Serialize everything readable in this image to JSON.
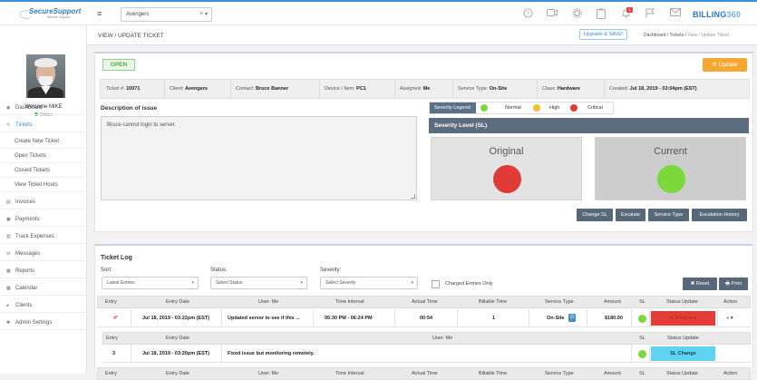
{
  "header": {
    "logo_main": "SecureSupport",
    "logo_sub": "Remote Support",
    "client_value": "Avengers",
    "clear_symbol": "×",
    "notification_count": "1",
    "brand_name": "BILLING",
    "brand_suffix": "360"
  },
  "user": {
    "welcome": "Welcome MIKE",
    "status": "Online"
  },
  "sidebar": {
    "items": [
      {
        "label": "Dashboard",
        "icon": "dashboard-icon"
      },
      {
        "label": "Tickets",
        "icon": "ticket-icon"
      },
      {
        "label": "Invoices",
        "icon": "invoice-icon"
      },
      {
        "label": "Payments",
        "icon": "payment-icon"
      },
      {
        "label": "Track Expenses",
        "icon": "expense-icon"
      },
      {
        "label": "Messages",
        "icon": "message-icon"
      },
      {
        "label": "Reports",
        "icon": "report-icon"
      },
      {
        "label": "Calendar",
        "icon": "calendar-icon"
      },
      {
        "label": "Clients",
        "icon": "clients-icon"
      },
      {
        "label": "Admin Settings",
        "icon": "settings-icon"
      }
    ],
    "subitems": [
      "Create New Ticket",
      "Open Tickets",
      "Closed Tickets",
      "View Ticket Hours"
    ]
  },
  "page": {
    "title": "VIEW / UPDATE TICKET",
    "upgrade_label": "Upgrade & SAVE!",
    "breadcrumb": [
      "Dashboard",
      "Tickets",
      "View / Update Ticket"
    ]
  },
  "ticket": {
    "status": "OPEN",
    "update_label": "Update",
    "info": [
      {
        "label": "Ticket #:",
        "value": "10071"
      },
      {
        "label": "Client:",
        "value": "Avengers"
      },
      {
        "label": "Contact:",
        "value": "Bruce Banner"
      },
      {
        "label": "Device / Item:",
        "value": "PC1"
      },
      {
        "label": "Assigned:",
        "value": "Me"
      },
      {
        "label": "Service Type:",
        "value": "On-Site"
      },
      {
        "label": "Class:",
        "value": "Hardware"
      },
      {
        "label": "Created:",
        "value": "Jul 18, 2019 - 03:04pm (EST)"
      }
    ],
    "description_label": "Description of issue",
    "description": "Bruce cannot login to server."
  },
  "severity": {
    "legend_label": "Severity Legend:",
    "levels": [
      {
        "label": "Normal",
        "color": "#7bd93c"
      },
      {
        "label": "High",
        "color": "#f2c12e"
      },
      {
        "label": "Critical",
        "color": "#e03a36"
      }
    ],
    "heading": "Severity Level (SL)",
    "original_label": "Original",
    "original_color": "#e03a36",
    "current_label": "Current",
    "current_color": "#7bd93c",
    "actions": [
      "Change SL",
      "Escalate",
      "Service Type",
      "Escalation History"
    ]
  },
  "log": {
    "title": "Ticket Log",
    "sort_label": "Sort:",
    "sort_value": "Latest Entries",
    "status_label": "Status:",
    "status_placeholder": "Select Status",
    "severity_label": "Severity:",
    "severity_placeholder": "Select Severity",
    "charged_label": "Charged Entries Only",
    "reset_label": "✖ Reset",
    "print_label": "🖶 Print",
    "columns": [
      "Entry",
      "Entry Date",
      "User: Me",
      "Time Interval",
      "Actual Time",
      "Billable Time",
      "Service Type",
      "Amount",
      "SL",
      "Status Update",
      "Action"
    ],
    "entry1": {
      "entry": "4*",
      "date": "Jul 18, 2019 - 03:22pm (EST)",
      "note": "Updated server to see if this ...",
      "interval": "05:30 PM - 06:24 PM",
      "actual": "00:54",
      "billable": "1",
      "service": "On-Site",
      "service_badge": "D",
      "amount": "$180.00",
      "status": "In Progress",
      "action_symbol": "≡ ▾"
    },
    "sub_columns": [
      "Entry",
      "Entry Date",
      "User: Me",
      "SL",
      "Status Update"
    ],
    "entry2": {
      "entry": "3",
      "date": "Jul 18, 2019 - 03:20pm (EST)",
      "note": "Fixed issue but monitoring remotely.",
      "status": "SL Change"
    }
  }
}
